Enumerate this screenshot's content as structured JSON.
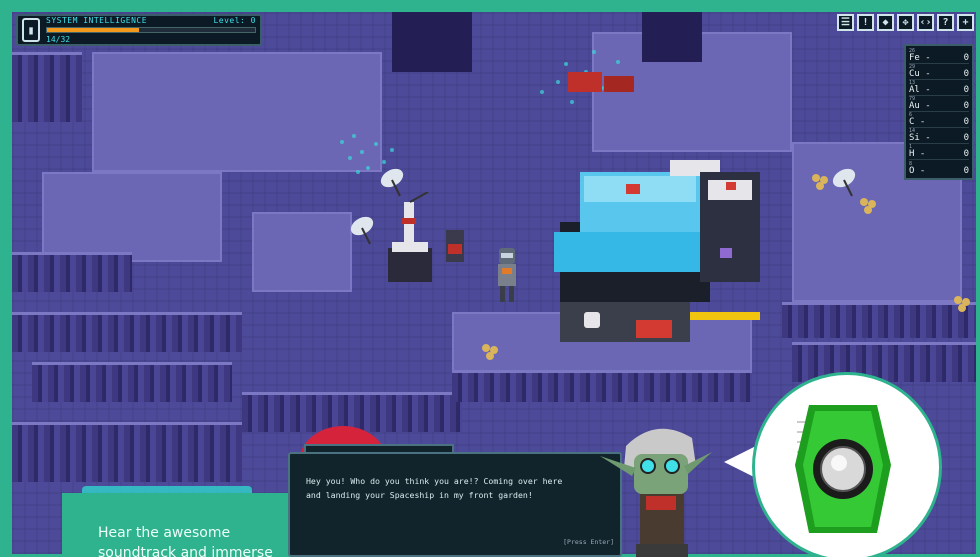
{
  "hud": {
    "title": "SYSTEM INTELLIGENCE",
    "level_label": "Level: 0",
    "progress": "14/32",
    "progress_fraction": 0.44,
    "bar_color": "#f39a1e"
  },
  "toolbar": {
    "icons": [
      "menu-icon",
      "alert-icon",
      "gem-icon",
      "gamepad-icon",
      "code-icon",
      "help-icon",
      "plus-icon"
    ],
    "glyphs": [
      "☰",
      "!",
      "◆",
      "✥",
      "‹›",
      "?",
      "+"
    ]
  },
  "resources": [
    {
      "num": "26",
      "symbol": "Fe",
      "dash": "-",
      "value": "0"
    },
    {
      "num": "29",
      "symbol": "Cu",
      "dash": "-",
      "value": "0"
    },
    {
      "num": "13",
      "symbol": "Al",
      "dash": "-",
      "value": "0"
    },
    {
      "num": "79",
      "symbol": "Au",
      "dash": "-",
      "value": "0"
    },
    {
      "num": "6",
      "symbol": "C",
      "dash": "-",
      "value": "0"
    },
    {
      "num": "14",
      "symbol": "Si",
      "dash": "-",
      "value": "0"
    },
    {
      "num": "1",
      "symbol": "H",
      "dash": "-",
      "value": "0"
    },
    {
      "num": "8",
      "symbol": "O",
      "dash": "-",
      "value": "0"
    }
  ],
  "dialog": {
    "line1": "Hey you! Who do you think you are!? Coming over here",
    "line2": "and landing your Spaceship in my front garden!",
    "hint": "[Press Enter]"
  },
  "promo": {
    "line1": "Hear the awesome",
    "line2": "soundtrack and immerse"
  },
  "colors": {
    "frame": "#2fb38f",
    "ground": "#4d4a9a",
    "plateau": "#6b67b5",
    "hud_text": "#3fe0e8"
  }
}
